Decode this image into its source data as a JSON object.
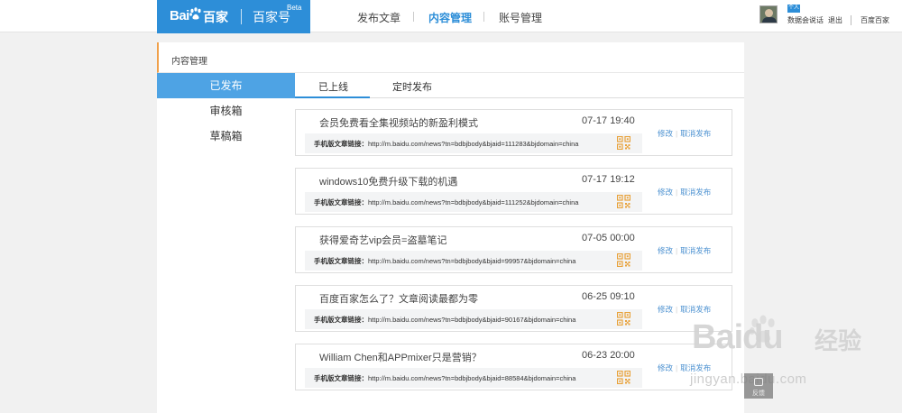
{
  "header": {
    "logo": {
      "bai": "Bai",
      "baidu_cn": "百家",
      "product": "百家号",
      "beta": "Beta"
    },
    "nav": [
      {
        "label": "发布文章"
      },
      {
        "label": "内容管理",
        "active": true
      },
      {
        "label": "账号管理"
      }
    ],
    "user": {
      "badge": "个人",
      "name": "数据会说话",
      "logout": "退出",
      "home": "百度百家"
    }
  },
  "panel": {
    "title": "内容管理",
    "sidebar": [
      {
        "label": "已发布",
        "active": true
      },
      {
        "label": "审核箱"
      },
      {
        "label": "草稿箱"
      }
    ],
    "tabs": [
      {
        "label": "已上线",
        "active": true
      },
      {
        "label": "定时发布"
      }
    ],
    "link_label": "手机版文章链接：",
    "actions": {
      "edit": "修改",
      "unpublish": "取消发布"
    },
    "articles": [
      {
        "title": "会员免费看全集视频站的新盈利模式",
        "time": "07-17 19:40",
        "url": "http://m.baidu.com/news?tn=bdbjbody&bjaid=111283&bjdomain=china"
      },
      {
        "title": "windows10免费升级下载的机遇",
        "time": "07-17 19:12",
        "url": "http://m.baidu.com/news?tn=bdbjbody&bjaid=111252&bjdomain=china"
      },
      {
        "title": "获得爱奇艺vip会员=盗墓笔记",
        "time": "07-05 00:00",
        "url": "http://m.baidu.com/news?tn=bdbjbody&bjaid=99957&bjdomain=china"
      },
      {
        "title": "百度百家怎么了？文章阅读最都为零",
        "time": "06-25 09:10",
        "url": "http://m.baidu.com/news?tn=bdbjbody&bjaid=90167&bjdomain=china"
      },
      {
        "title": "William Chen和APPmixer只是营销？",
        "time": "06-23 20:00",
        "url": "http://m.baidu.com/news?tn=bdbjbody&bjaid=88584&bjdomain=china"
      }
    ]
  },
  "watermark": {
    "logo": "Baidu",
    "cn": "经验",
    "url": "jingyan.baidu.com",
    "feedback": "反馈"
  },
  "colors": {
    "brand": "#2d8ed8",
    "sidebar_active": "#4ea3e4",
    "accent_bar": "#f0a04b",
    "qr": "#e8a23a",
    "action_link": "#4a90d0"
  }
}
